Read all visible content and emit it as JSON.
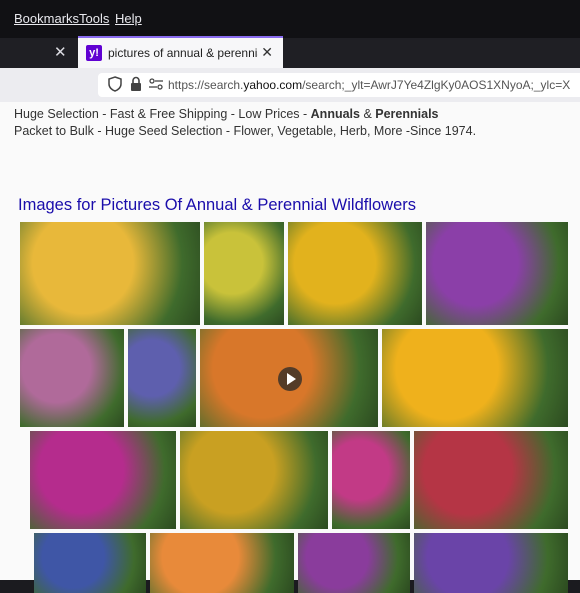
{
  "menubar": {
    "items": [
      "Bookmarks",
      "Tools",
      "Help"
    ]
  },
  "tab": {
    "title": "pictures of annual & perennial",
    "favicon": "y!",
    "close": "✕"
  },
  "prev_tab_close": "✕",
  "address": {
    "url_prefix": "https://search.",
    "url_domain": "yahoo.com",
    "url_rest": "/search;_ylt=AwrJ7Ye4ZlgKy0AOS1XNyoA;_ylc=X"
  },
  "snippet": {
    "line1_prefix": "Huge Selection - Fast & Free Shipping - Low Prices - ",
    "line1_bold1": "Annuals",
    "line1_amp": " & ",
    "line1_bold2": "Perennials",
    "line2": "Packet to Bulk - Huge Seed Selection - Flower, Vegetable, Herb, More -Since 1974."
  },
  "images_heading": "Images for Pictures Of Annual & Perennial Wildflowers",
  "images": [
    {
      "name": "yellow-petunias-image",
      "color": "#e8b83a"
    },
    {
      "name": "yellow-daylilies-image",
      "color": "#c9c23a"
    },
    {
      "name": "black-eyed-susan-image",
      "color": "#e2b21d"
    },
    {
      "name": "purple-phlox-image",
      "color": "#8b3fa8"
    },
    {
      "name": "purple-coneflower-image",
      "color": "#b06a9a"
    },
    {
      "name": "blue-salvia-image",
      "color": "#5e5fae"
    },
    {
      "name": "orange-zinnia-video-thumbnail",
      "color": "#d8772a"
    },
    {
      "name": "yellow-coreopsis-image",
      "color": "#efb11c"
    },
    {
      "name": "magenta-petunias-image",
      "color": "#b52c8d"
    },
    {
      "name": "mixed-wildflowers-image",
      "color": "#c9a022"
    },
    {
      "name": "pink-dianthus-image",
      "color": "#c23a86"
    },
    {
      "name": "red-white-dianthus-image",
      "color": "#b53545"
    },
    {
      "name": "blue-wildflowers-image",
      "color": "#3f56a6"
    },
    {
      "name": "orange-gerbera-image",
      "color": "#e88a3a"
    },
    {
      "name": "purple-primrose-image",
      "color": "#8a3c9c"
    },
    {
      "name": "purple-salvia-image",
      "color": "#6a44a8"
    }
  ]
}
